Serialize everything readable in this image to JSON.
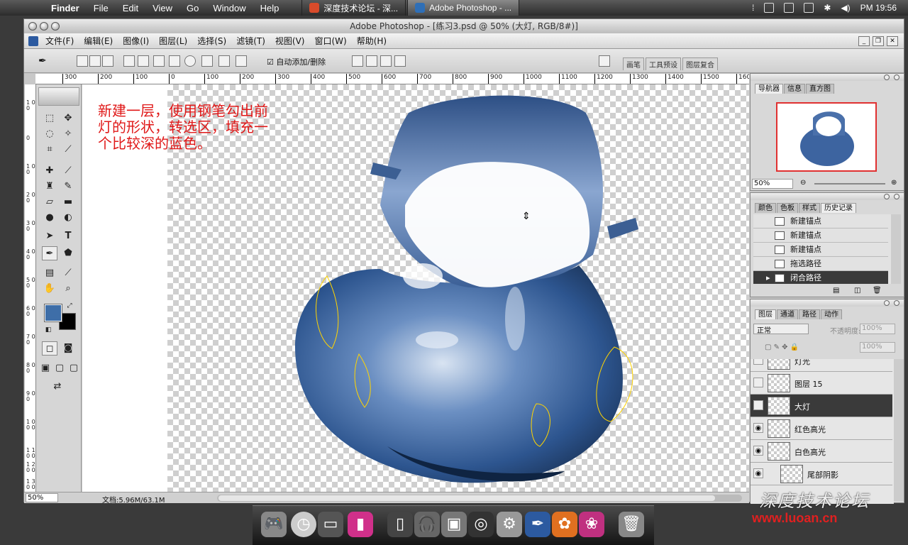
{
  "menubar": {
    "app": "Finder",
    "items": [
      "File",
      "Edit",
      "View",
      "Go",
      "Window",
      "Help"
    ],
    "tabs": [
      "深度技术论坛 - 深...",
      "Adobe Photoshop - ..."
    ],
    "clock": "PM 19:56"
  },
  "window": {
    "title": "Adobe Photoshop - [练习3.psd @ 50% (大灯, RGB/8#)]",
    "menu": [
      "文件(F)",
      "编辑(E)",
      "图像(I)",
      "图层(L)",
      "选择(S)",
      "滤镜(T)",
      "视图(V)",
      "窗口(W)",
      "帮助(H)"
    ]
  },
  "options": {
    "auto_add_delete": "自动添加/删除",
    "panel_tabs": [
      "画笔",
      "工具预设",
      "图层复合"
    ]
  },
  "ruler": {
    "labels": [
      "300",
      "200",
      "100",
      "0",
      "100",
      "200",
      "300",
      "400",
      "500",
      "600",
      "700",
      "800",
      "900",
      "1000",
      "1100",
      "1200",
      "1300",
      "1400",
      "1500",
      "160"
    ],
    "vlabels": [
      "1 0 0",
      "0",
      "1 0 0",
      "2 0 0",
      "3 0 0",
      "4 0 0",
      "5 0 0",
      "6 0 0",
      "7 0 0",
      "8 0 0",
      "9 0 0",
      "1 0 0 0",
      "1 1 0 0",
      "1 2 0 0",
      "1 3 0 0"
    ]
  },
  "annotation": "新建一层，使用钢笔勾出前灯的形状，转选区，填充一个比较深的蓝色。",
  "status": {
    "zoom": "50%",
    "doc": "文档:5.96M/63.1M"
  },
  "navigator": {
    "tabs": [
      "导航器",
      "信息",
      "直方图"
    ],
    "zoom": "50%"
  },
  "history": {
    "tabs": [
      "颜色",
      "色板",
      "样式",
      "历史记录"
    ],
    "items": [
      "新建锚点",
      "新建锚点",
      "新建锚点",
      "拖选路径",
      "闭合路径"
    ]
  },
  "layers": {
    "tabs": [
      "图层",
      "通道",
      "路径",
      "动作"
    ],
    "blend": "正常",
    "opacity_label": "不透明度:",
    "opacity": "100%",
    "fill": "100%",
    "rows": [
      "灯光",
      "图层 15",
      "大灯",
      "红色高光",
      "白色高光",
      "尾部阴影"
    ]
  },
  "watermark": {
    "url": "www.luoan.cn",
    "logo": "深度技术论坛"
  },
  "colors": {
    "foreground": "#3e6ea8",
    "background": "#000000",
    "annotation": "#e01818",
    "selection": "#ffd400"
  }
}
